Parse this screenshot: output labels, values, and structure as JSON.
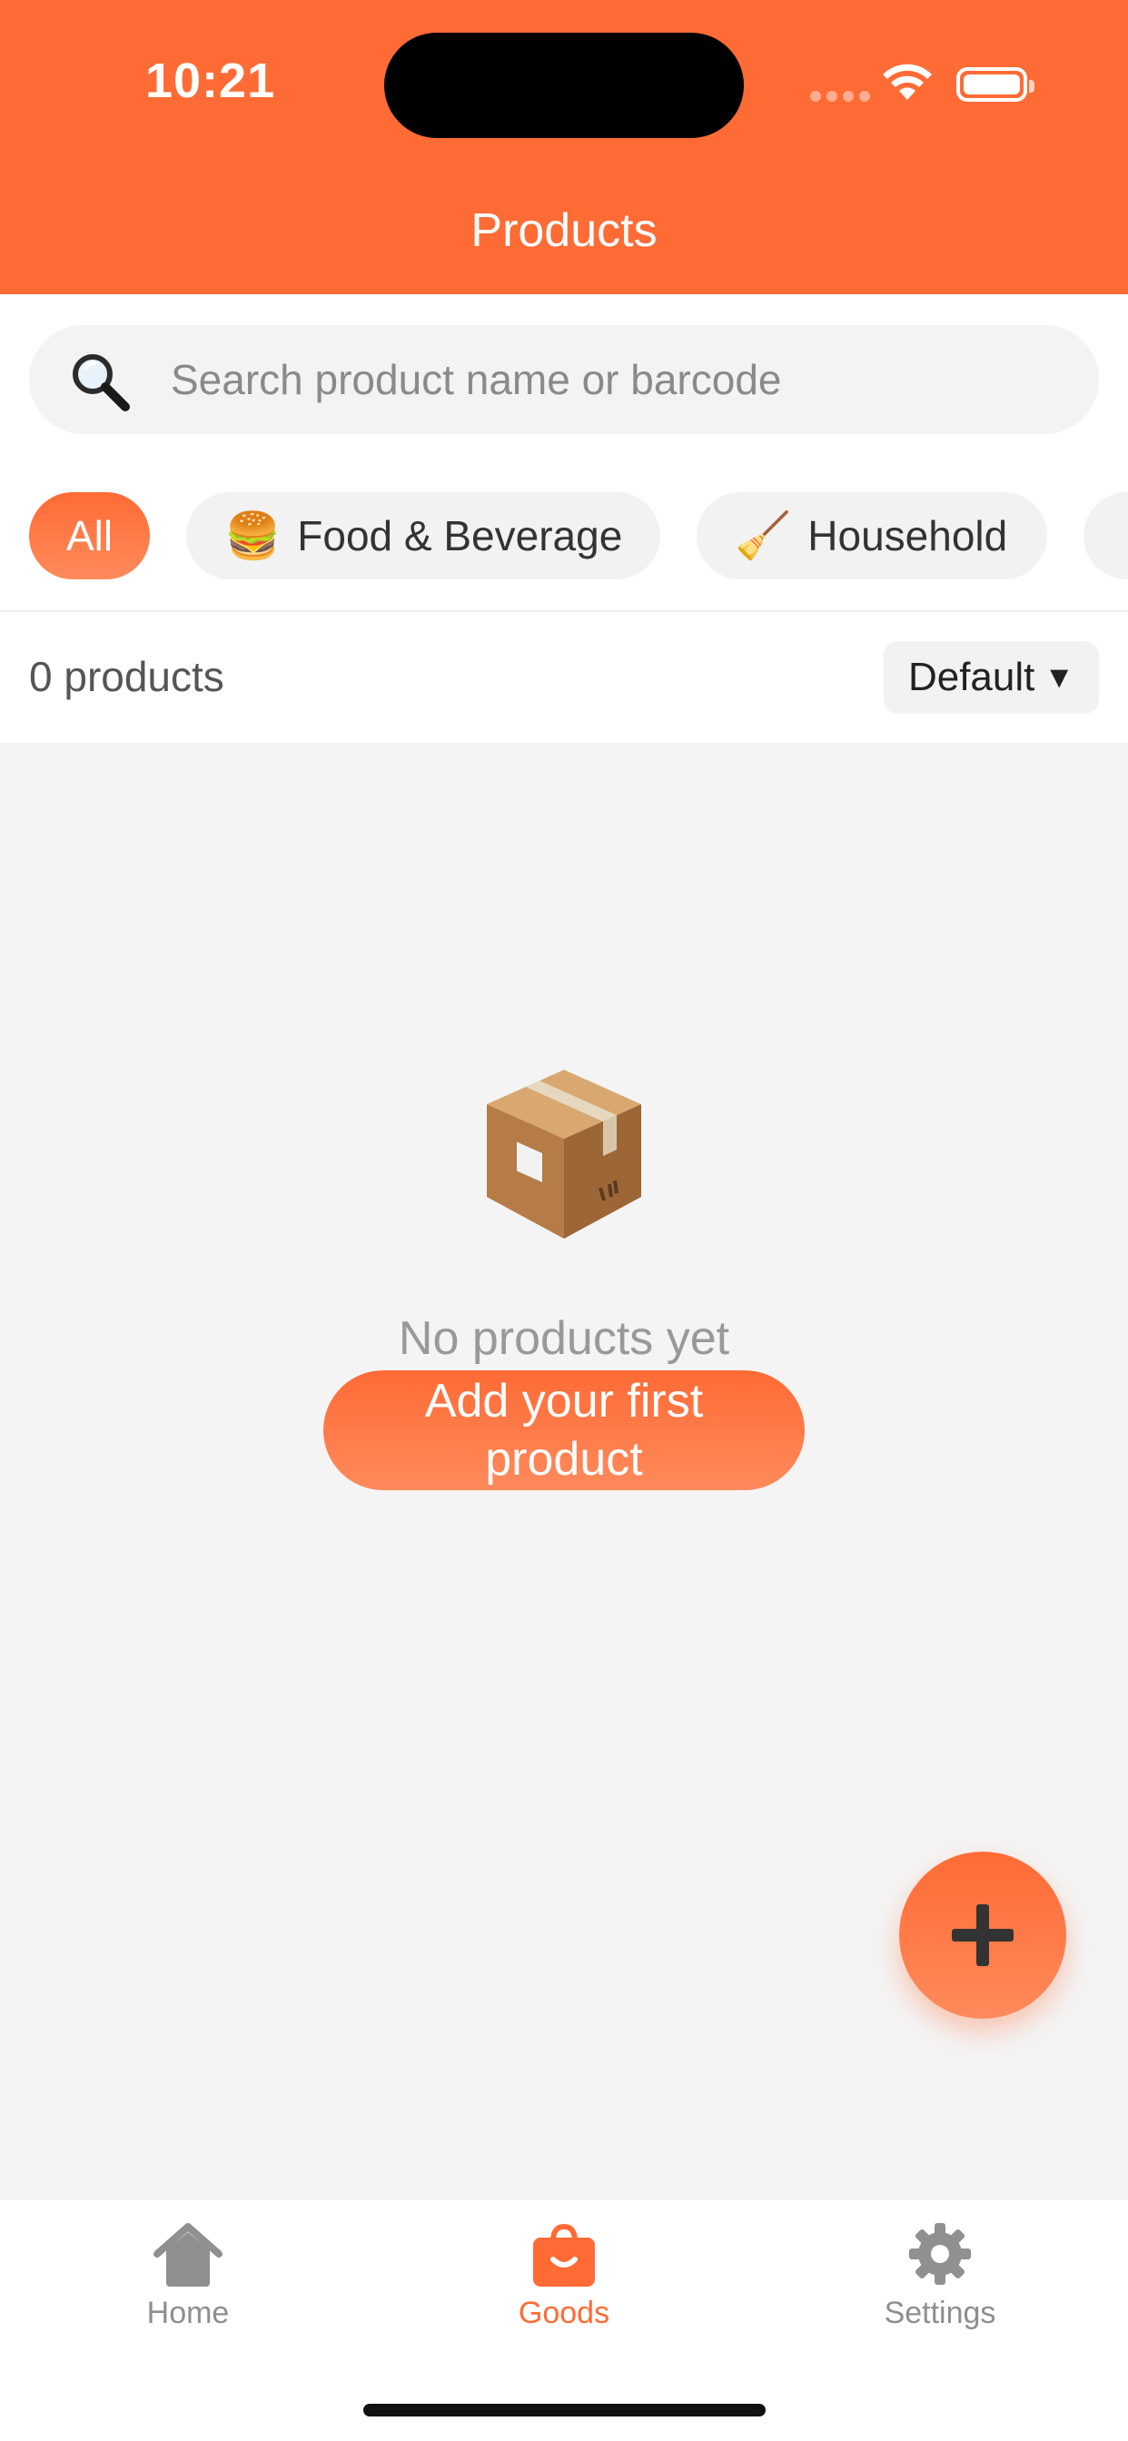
{
  "status_bar": {
    "time": "10:21"
  },
  "header": {
    "title": "Products"
  },
  "search": {
    "placeholder": "Search product name or barcode"
  },
  "categories": [
    {
      "label": "All",
      "emoji": "",
      "active": true
    },
    {
      "label": "Food & Beverage",
      "emoji": "🍔",
      "active": false
    },
    {
      "label": "Household",
      "emoji": "🧹",
      "active": false
    }
  ],
  "list_header": {
    "count_label": "0 products",
    "sort_label": "Default",
    "sort_caret": "▼"
  },
  "empty_state": {
    "icon": "package-icon",
    "message": "No products yet",
    "button_label": "Add your first product"
  },
  "fab": {
    "icon": "plus-icon"
  },
  "tabbar": {
    "items": [
      {
        "label": "Home",
        "icon": "house-icon",
        "active": false
      },
      {
        "label": "Goods",
        "icon": "shopping-bag-icon",
        "active": true
      },
      {
        "label": "Settings",
        "icon": "gear-icon",
        "active": false
      }
    ]
  },
  "colors": {
    "accent": "#ff6b35",
    "accent_light": "#ff8a5c",
    "background": "#f4f4f4"
  }
}
